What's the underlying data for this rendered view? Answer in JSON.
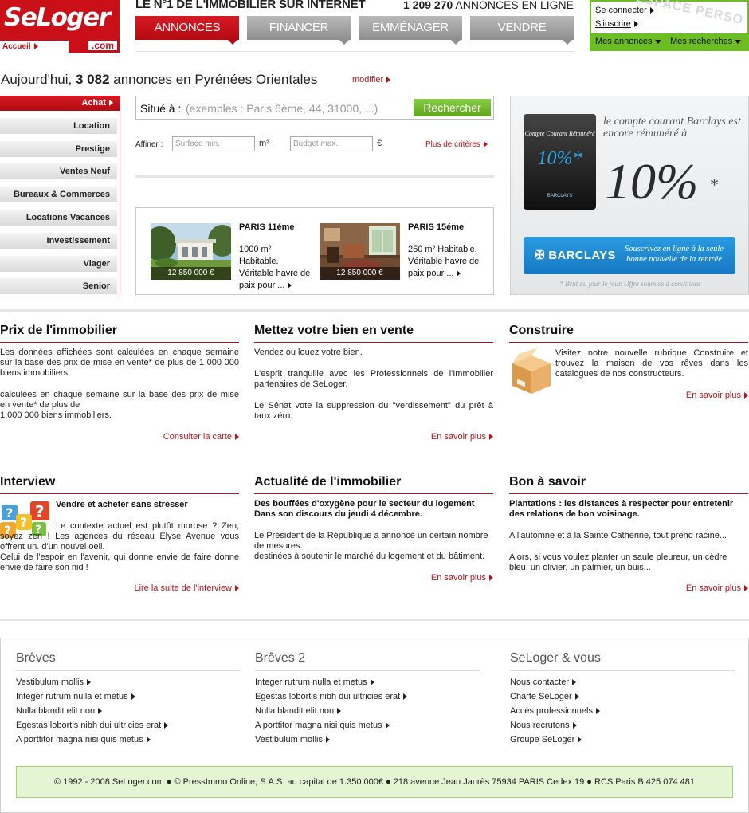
{
  "header": {
    "logo_text": "SeLoger",
    "logo_suffix": ".com",
    "home_link": "Accueil",
    "tagline": "LE N°1 DE L'IMMOBILIER SUR INTERNET",
    "listing_count": "1 209 270",
    "listing_count_suffix": "ANNONCES EN LIGNE",
    "tabs": [
      {
        "label": "ANNONCES",
        "active": true
      },
      {
        "label": "FINANCER",
        "active": false
      },
      {
        "label": "EMMÉNAGER",
        "active": false
      },
      {
        "label": "VENDRE",
        "active": false
      }
    ]
  },
  "userbox": {
    "watermark": "ESPACE PERSO",
    "login": "Se connecter",
    "signup": "S'inscrire",
    "my_ads": "Mes annonces",
    "my_searches": "Mes recherches"
  },
  "headline": {
    "prefix": "Aujourd'hui, ",
    "count": "3 082",
    "suffix": " annonces en Pyrénées Orientales",
    "modify": "modifier"
  },
  "leftmenu": {
    "items": [
      {
        "label": "Achat",
        "active": true
      },
      {
        "label": "Location",
        "active": false
      },
      {
        "label": "Prestige",
        "active": false
      },
      {
        "label": "Ventes Neuf",
        "active": false
      },
      {
        "label": "Bureaux & Commerces",
        "active": false
      },
      {
        "label": "Locations Vacances",
        "active": false
      },
      {
        "label": "Investissement",
        "active": false
      },
      {
        "label": "Viager",
        "active": false
      },
      {
        "label": "Senior",
        "active": false
      }
    ]
  },
  "search": {
    "label": "Situé à :",
    "placeholder": "(exemples : Paris 6ème, 44, 31000, ...)",
    "button": "Rechercher",
    "refine_label": "Affiner :",
    "surface_placeholder": "Surface min.",
    "surface_unit": "m²",
    "budget_placeholder": "Budget max.",
    "budget_unit": "€",
    "more_criteria": "Plus de critères"
  },
  "featured": [
    {
      "title": "PARIS 11éme",
      "price": "12 850 000 €",
      "desc": "1000 m² Habitable. Véritable havre de paix pour ..."
    },
    {
      "title": "PARIS 15éme",
      "price": "12 850 000 €",
      "desc": "250 m² Habitable. Véritable havre de paix pour ..."
    }
  ],
  "ad": {
    "card_title": "Compte Courant Rémunéré",
    "card_rate": "10%*",
    "card_bank": "BARCLAYS",
    "text": "le compte courant Barclays est encore rémunéré à",
    "rate": "10%",
    "star": "*",
    "bank": "BARCLAYS",
    "subscribe": "Souscrivez en ligne à la seule bonne nouvelle de la rentrée",
    "fine_print": "* Brut au jour le jour. Offre soumise à conditions"
  },
  "blocks": {
    "prix": {
      "title": "Prix de l'immobilier",
      "p1": "Les données affichées sont calculées en chaque semaine sur la base des prix de mise en vente* de plus de 1 000 000 biens immobiliers.",
      "p2a": "calculées en chaque semaine sur la base des prix de mise en vente* de plus de",
      "p2b": "1 000 000 biens immobiliers.",
      "link": "Consulter la carte"
    },
    "vente": {
      "title": "Mettez votre bien en vente",
      "p1": "Vendez ou louez votre bien.",
      "p2": "L'esprit tranquille avec les Professionnels de l'Immobilier partenaires de SeLoger.",
      "p3": "Le Sénat vote la suppression du \"verdissement\" du prêt à taux zéro.",
      "link": "En savoir plus"
    },
    "construire": {
      "title": "Construire",
      "p1": "Visitez notre nouvelle rubrique Construire et trouvez la maison de vos rêves dans les catalogues de nos constructeurs.",
      "link": "En savoir plus"
    },
    "interview": {
      "title": "Interview",
      "subtitle": "Vendre et acheter sans stresser",
      "p1": "Le contexte actuel est plutôt morose ? Zen, soyez zen ! Les agences du réseau Elyse Avenue vous offrent un. d'un nouvel oeil.",
      "p2": "Celui de l'espoir en l'avenir, qui donne envie de faire donne envie de faire son nid !",
      "link": "Lire la suite de l'interview"
    },
    "actualite": {
      "title": "Actualité de l'immobilier",
      "subtitle": "Des bouffées d'oxygène pour le secteur du logement Dans son discours du jeudi 4 décembre.",
      "p1": "Le Président de la République a annoncé un certain nombre de mesures.",
      "p2": "destinées à soutenir le marché du logement et du bâtiment.",
      "link": "En savoir plus"
    },
    "bonasavoir": {
      "title": "Bon à savoir",
      "subtitle": "Plantations : les distances à respecter pour entretenir des relations de bon voisinage.",
      "p1": "A l'automne et à la Sainte Catherine, tout prend racine...",
      "p2": "Alors, si vous voulez planter un saule pleureur, un cèdre bleu, un olivier, un palmier, un buis...",
      "link": "En savoir plus"
    }
  },
  "footer": {
    "columns": [
      {
        "title": "Brêves",
        "links": [
          "Vestibulum mollis",
          "Integer rutrum nulla et metus",
          "Nulla blandit elit non",
          "Egestas lobortis nibh dui ultricies erat",
          "A porttitor magna nisi quis metus"
        ]
      },
      {
        "title": "Brêves 2",
        "links": [
          "Integer rutrum nulla et metus",
          "Egestas lobortis nibh dui ultricies erat",
          "Nulla blandit elit non",
          "A porttitor magna nisi quis metus",
          "Vestibulum mollis"
        ]
      },
      {
        "title": "SeLoger & vous",
        "links": [
          "Nous contacter",
          "Charte SeLoger",
          "Accès professionnels",
          "Nous recrutons",
          "Groupe SeLoger"
        ]
      }
    ],
    "copyright": "© 1992 - 2008 SeLoger.com ● © PressImmo Online, S.A.S. au capital de 1.350.000€ ● 218 avenue Jean Jaurès 75934 PARIS Cedex 19 ● RCS Paris B 425 074 481"
  },
  "colors": {
    "brand_red": "#c90f17",
    "accent_green": "#6cbd24"
  }
}
